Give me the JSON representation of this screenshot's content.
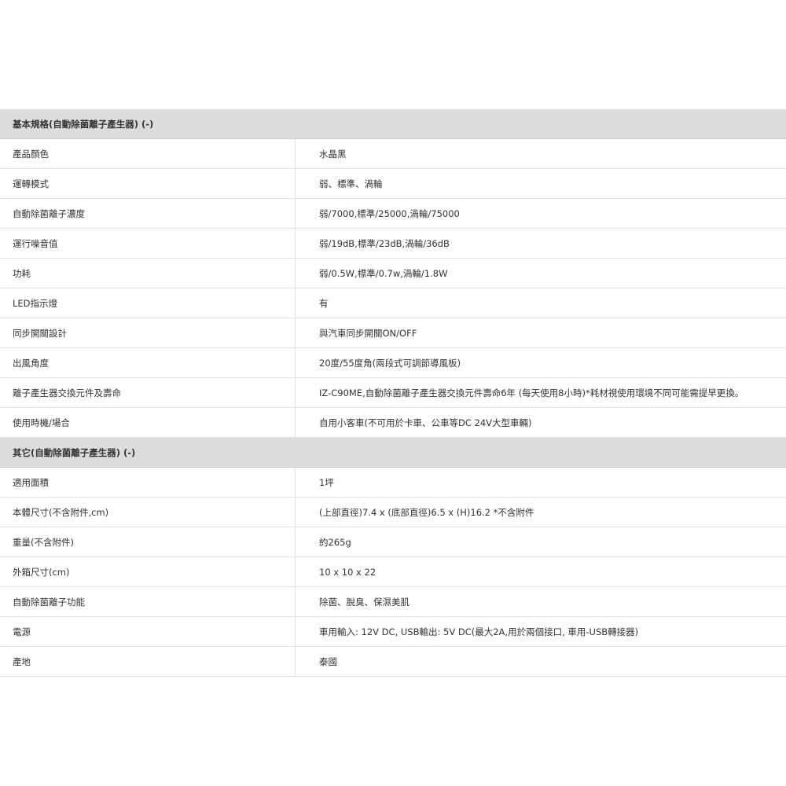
{
  "sections": [
    {
      "title": "基本規格(自動除菌離子產生器) (-)",
      "rows": [
        {
          "label": "產品顏色",
          "value": "水晶黑"
        },
        {
          "label": "運轉模式",
          "value": "弱、標準、渦輪"
        },
        {
          "label": "自動除菌離子濃度",
          "value": "弱/7000,標準/25000,渦輪/75000"
        },
        {
          "label": "運行噪音值",
          "value": "弱/19dB,標準/23dB,渦輪/36dB"
        },
        {
          "label": "功耗",
          "value": "弱/0.5W,標準/0.7w,渦輪/1.8W"
        },
        {
          "label": "LED指示燈",
          "value": "有"
        },
        {
          "label": "同步開關設計",
          "value": "與汽車同步開關ON/OFF"
        },
        {
          "label": "出風角度",
          "value": "20度/55度角(兩段式可調節導風板)"
        },
        {
          "label": "離子產生器交換元件及壽命",
          "value": "IZ-C90ME,自動除菌離子產生器交換元件壽命6年 (每天使用8小時)*耗材視使用環境不同可能需提早更換。"
        },
        {
          "label": "使用時機/場合",
          "value": "自用小客車(不可用於卡車、公車等DC 24V大型車輛)"
        }
      ]
    },
    {
      "title": "其它(自動除菌離子產生器) (-)",
      "rows": [
        {
          "label": "適用面積",
          "value": "1坪"
        },
        {
          "label": "本體尺寸(不含附件,cm)",
          "value": "(上部直徑)7.4 x (底部直徑)6.5 x (H)16.2 *不含附件"
        },
        {
          "label": "重量(不含附件)",
          "value": "約265g"
        },
        {
          "label": "外箱尺寸(cm)",
          "value": "10 x 10 x 22"
        },
        {
          "label": "自動除菌離子功能",
          "value": "除菌、脫臭、保濕美肌"
        },
        {
          "label": "電源",
          "value": "車用輸入: 12V DC, USB輸出: 5V DC(最大2A,用於兩個接口, 車用-USB轉接器)"
        },
        {
          "label": "產地",
          "value": "泰國"
        }
      ]
    }
  ]
}
